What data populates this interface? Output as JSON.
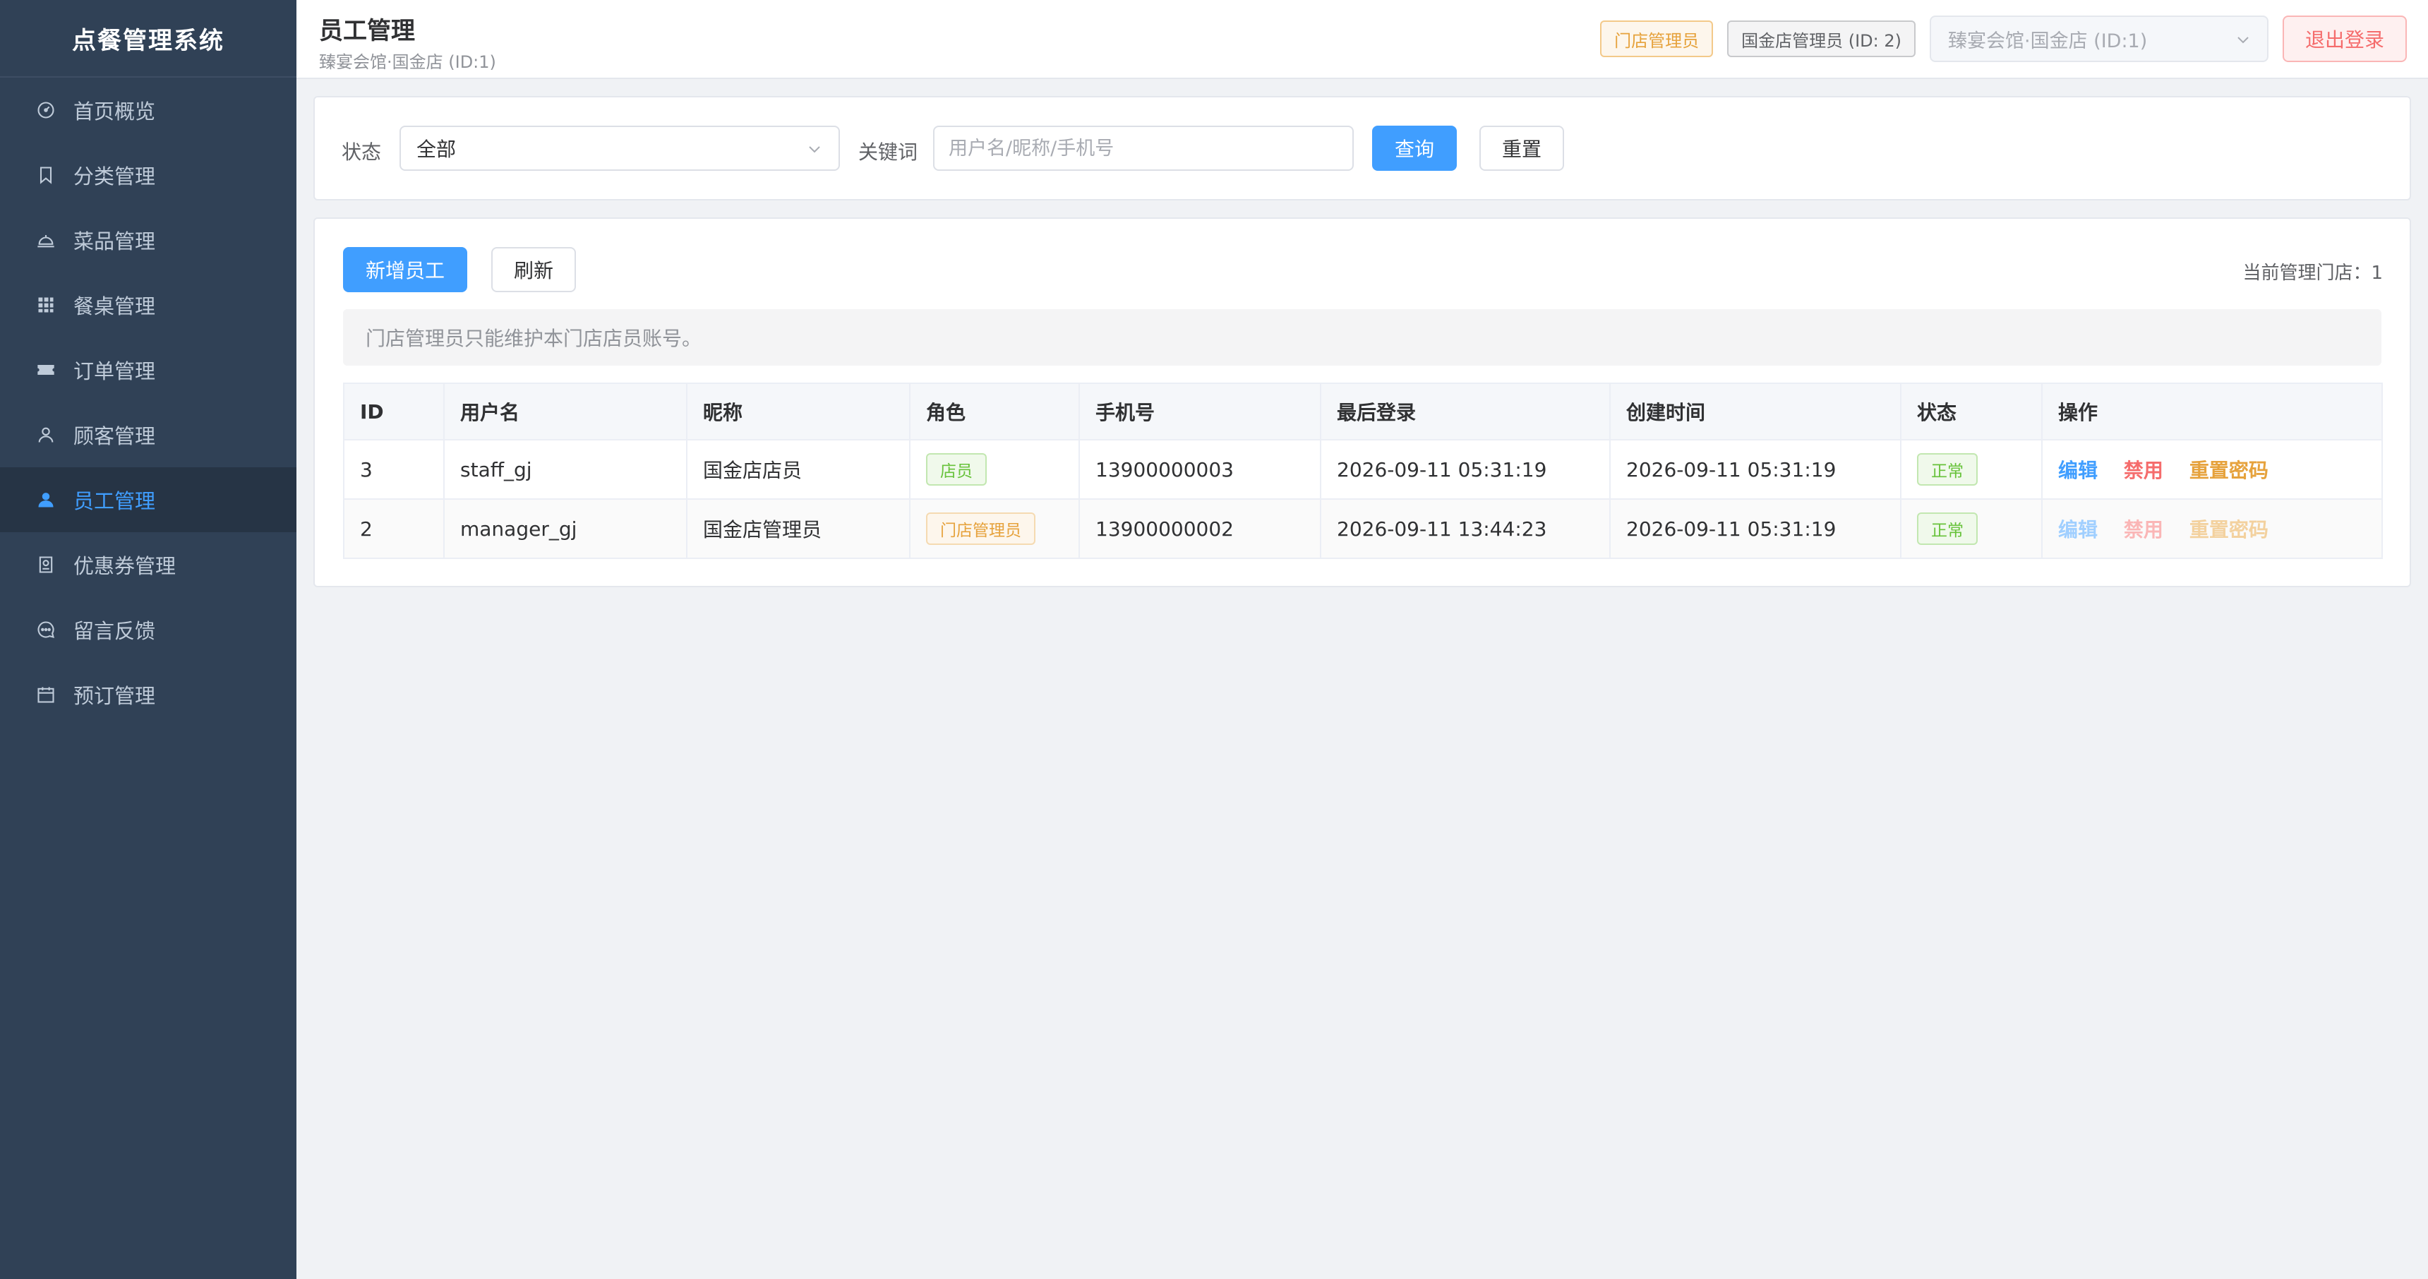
{
  "app": {
    "title": "点餐管理系统"
  },
  "sidebar": {
    "items": [
      {
        "label": "首页概览",
        "icon": "dashboard-icon"
      },
      {
        "label": "分类管理",
        "icon": "bookmark-icon"
      },
      {
        "label": "菜品管理",
        "icon": "dish-cloche-icon"
      },
      {
        "label": "餐桌管理",
        "icon": "grid-icon"
      },
      {
        "label": "订单管理",
        "icon": "ticket-icon"
      },
      {
        "label": "顾客管理",
        "icon": "user-icon"
      },
      {
        "label": "员工管理",
        "icon": "user-filled-icon",
        "active": true
      },
      {
        "label": "优惠券管理",
        "icon": "coupon-icon"
      },
      {
        "label": "留言反馈",
        "icon": "chat-icon"
      },
      {
        "label": "预订管理",
        "icon": "calendar-icon"
      }
    ]
  },
  "header": {
    "title": "员工管理",
    "subtitle": "臻宴会馆·国金店 (ID:1)",
    "role_tag": "门店管理员",
    "user_tag": "国金店管理员 (ID: 2)",
    "store_select": "臻宴会馆·国金店 (ID:1)",
    "logout_label": "退出登录"
  },
  "filter": {
    "status_label": "状态",
    "status_value": "全部",
    "keyword_label": "关键词",
    "keyword_value": "",
    "keyword_placeholder": "用户名/昵称/手机号",
    "query_label": "查询",
    "reset_label": "重置"
  },
  "toolbar": {
    "add_label": "新增员工",
    "refresh_label": "刷新",
    "store_count": "当前管理门店：1"
  },
  "notice": "门店管理员只能维护本门店店员账号。",
  "table": {
    "columns": [
      "ID",
      "用户名",
      "昵称",
      "角色",
      "手机号",
      "最后登录",
      "创建时间",
      "状态",
      "操作"
    ],
    "rows": [
      {
        "id": "3",
        "username": "staff_gj",
        "nickname": "国金店店员",
        "role": "店员",
        "phone": "13900000003",
        "last_login": "2026-09-11 05:31:19",
        "created": "2026-09-11 05:31:19",
        "status": "正常",
        "actions": {
          "edit": "编辑",
          "disable": "禁用",
          "reset": "重置密码"
        }
      },
      {
        "id": "2",
        "username": "manager_gj",
        "nickname": "国金店管理员",
        "role": "门店管理员",
        "phone": "13900000002",
        "last_login": "2026-09-11 13:44:23",
        "created": "2026-09-11 05:31:19",
        "status": "正常",
        "actions": {
          "edit": "编辑",
          "disable": "禁用",
          "reset": "重置密码"
        }
      }
    ]
  }
}
